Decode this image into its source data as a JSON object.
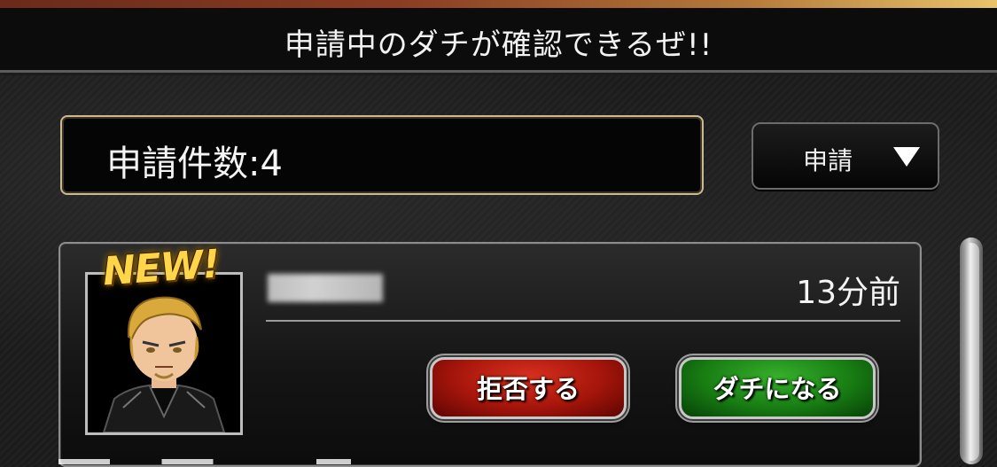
{
  "header": {
    "title": "申請中のダチが確認できるぜ!!"
  },
  "summary": {
    "count_label": "申請件数:4"
  },
  "filter": {
    "selected": "申請",
    "icon": "chevron-down-icon"
  },
  "requests": [
    {
      "badge": "NEW!",
      "username_redacted": true,
      "time": "13分前",
      "reject_label": "拒否する",
      "accept_label": "ダチになる",
      "avatar_icon": "avatar-blond-man"
    }
  ],
  "colors": {
    "reject": "#b3190e",
    "accept": "#1f8a18",
    "badge": "#ffd54a",
    "frame": "#cbb98f"
  }
}
